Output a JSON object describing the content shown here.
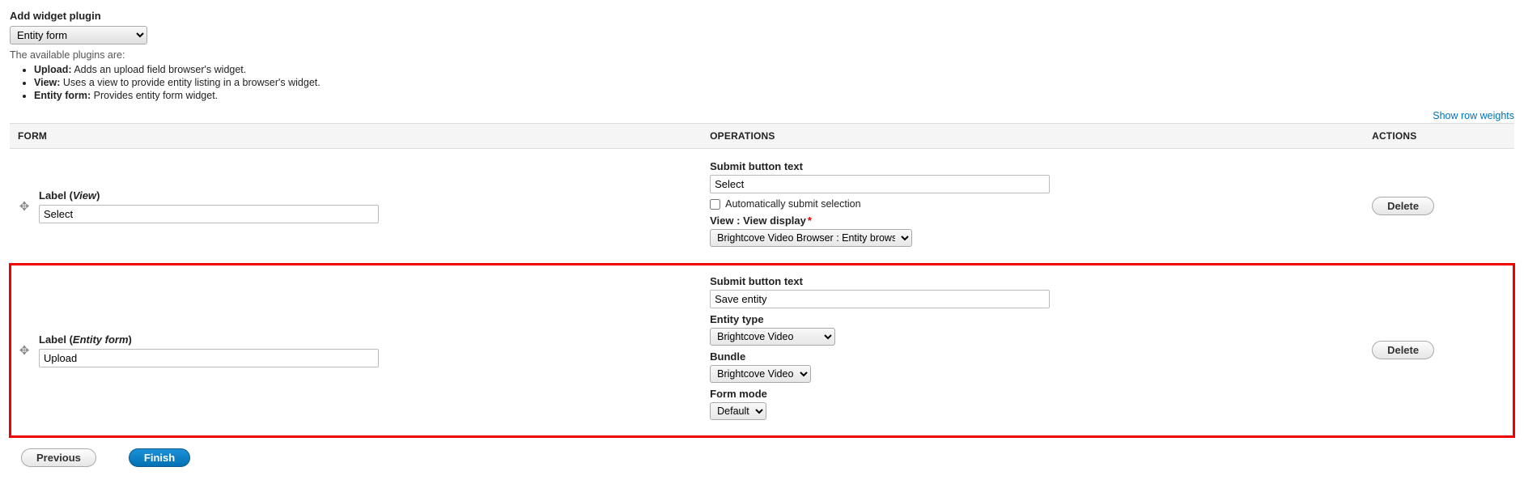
{
  "header": {
    "add_widget_label": "Add widget plugin",
    "plugin_select_value": "Entity form",
    "available_text": "The available plugins are:",
    "plugins": [
      {
        "name": "Upload:",
        "desc": "Adds an upload field browser's widget."
      },
      {
        "name": "View:",
        "desc": "Uses a view to provide entity listing in a browser's widget."
      },
      {
        "name": "Entity form:",
        "desc": "Provides entity form widget."
      }
    ]
  },
  "table": {
    "show_row_weights": "Show row weights",
    "columns": {
      "form": "FORM",
      "operations": "OPERATIONS",
      "actions": "ACTIONS"
    }
  },
  "row1": {
    "label_prefix": "Label (",
    "label_type": "View",
    "label_suffix": ")",
    "label_value": "Select",
    "submit_btn_label": "Submit button text",
    "submit_btn_value": "Select",
    "auto_submit_label": "Automatically submit selection",
    "view_display_label": "View : View display",
    "view_display_value": "Brightcove Video Browser : Entity browser",
    "delete": "Delete"
  },
  "row2": {
    "label_prefix": "Label (",
    "label_type": "Entity form",
    "label_suffix": ")",
    "label_value": "Upload",
    "submit_btn_label": "Submit button text",
    "submit_btn_value": "Save entity",
    "entity_type_label": "Entity type",
    "entity_type_value": "Brightcove Video",
    "bundle_label": "Bundle",
    "bundle_value": "Brightcove Video",
    "form_mode_label": "Form mode",
    "form_mode_value": "Default",
    "delete": "Delete"
  },
  "footer": {
    "previous": "Previous",
    "finish": "Finish"
  }
}
